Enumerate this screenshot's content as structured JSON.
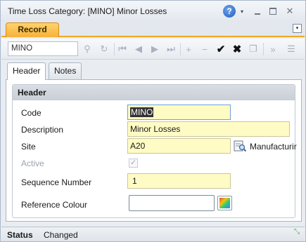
{
  "window": {
    "title": "Time Loss Category: [MINO] Minor Losses",
    "help_glyph": "?",
    "menu_glyph": "▾",
    "close_glyph": "✕"
  },
  "record_tab": {
    "label": "Record",
    "collapse_glyph": "▾"
  },
  "toolbar": {
    "search_value": "MINO",
    "tools": [
      {
        "name": "search-icon",
        "glyph": "⚲"
      },
      {
        "name": "refresh-icon",
        "glyph": "↻"
      },
      {
        "name": "first-record-icon",
        "glyph": "⏮"
      },
      {
        "name": "previous-record-icon",
        "glyph": "◀"
      },
      {
        "name": "next-record-icon",
        "glyph": "▶"
      },
      {
        "name": "last-record-icon",
        "glyph": "⏭"
      },
      {
        "name": "add-icon",
        "glyph": "+"
      },
      {
        "name": "remove-icon",
        "glyph": "−"
      },
      {
        "name": "save-check-icon",
        "glyph": "✔"
      },
      {
        "name": "cancel-icon",
        "glyph": "✖"
      },
      {
        "name": "copy-icon",
        "glyph": "❐"
      },
      {
        "name": "collapse-panel-icon",
        "glyph": "»"
      },
      {
        "name": "list-icon",
        "glyph": "☰"
      }
    ]
  },
  "tabs": [
    {
      "label": "Header",
      "active": true
    },
    {
      "label": "Notes",
      "active": false
    }
  ],
  "header_group": {
    "title": "Header",
    "fields": {
      "code": {
        "label": "Code",
        "value": "MINO"
      },
      "description": {
        "label": "Description",
        "value": "Minor Losses"
      },
      "site": {
        "label": "Site",
        "value": "A20",
        "lookup_text": "Manufacturir"
      },
      "active": {
        "label": "Active",
        "checked": true,
        "glyph": "✓"
      },
      "sequence_number": {
        "label": "Sequence Number",
        "value": "1"
      },
      "reference_colour": {
        "label": "Reference Colour",
        "value": ""
      }
    }
  },
  "status": {
    "label": "Status",
    "value": "Changed",
    "resize_glyph": "⤡"
  },
  "colors": {
    "record_tab_accent": "#f5a623",
    "mandatory_field_bg": "#fffbc4",
    "panel_header_bg": "#c9cfd6"
  }
}
